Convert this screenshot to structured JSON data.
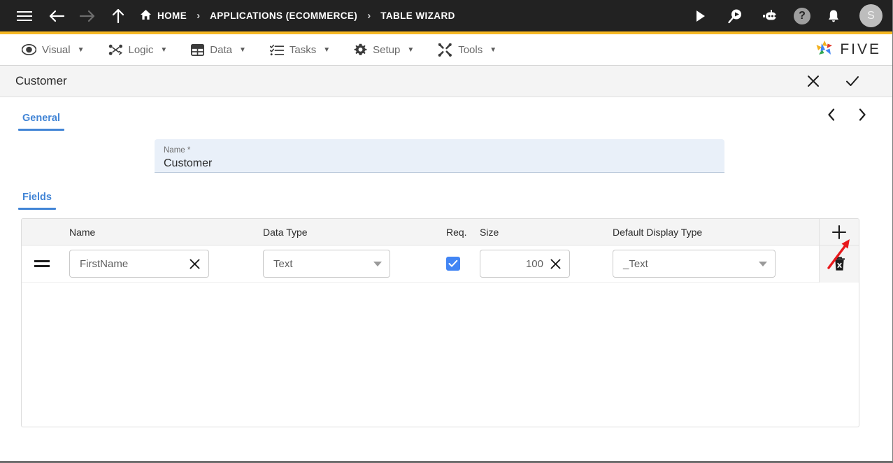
{
  "topbar": {
    "menu_icon": "hamburger-icon",
    "back_icon": "arrow-left-icon",
    "forward_icon": "arrow-right-icon",
    "up_icon": "arrow-up-icon",
    "breadcrumbs": [
      {
        "label": "HOME",
        "icon": "home-icon"
      },
      {
        "label": "APPLICATIONS (ECOMMERCE)",
        "icon": ""
      },
      {
        "label": "TABLE WIZARD",
        "icon": ""
      }
    ],
    "separator": "›",
    "actions": [
      {
        "name": "run-icon",
        "glyph": "▶"
      },
      {
        "name": "search-chat-icon",
        "glyph": ""
      },
      {
        "name": "chatbot-icon",
        "glyph": ""
      },
      {
        "name": "help-icon",
        "glyph": "?"
      },
      {
        "name": "notifications-bell-icon",
        "glyph": ""
      }
    ],
    "avatar_initial": "S",
    "accent_color": "#f6b823",
    "bg_color": "#222222"
  },
  "menubar": {
    "items": [
      {
        "label": "Visual",
        "icon": "eye-icon",
        "caret": "▼"
      },
      {
        "label": "Logic",
        "icon": "logic-nodes-icon",
        "caret": "▼"
      },
      {
        "label": "Data",
        "icon": "table-grid-icon",
        "caret": "▼"
      },
      {
        "label": "Tasks",
        "icon": "checklist-icon",
        "caret": "▼"
      },
      {
        "label": "Setup",
        "icon": "gear-icon",
        "caret": "▼"
      },
      {
        "label": "Tools",
        "icon": "tools-crossed-icon",
        "caret": "▼"
      }
    ],
    "brand": {
      "text": "FIVE",
      "logo": "five-star-logo"
    }
  },
  "record_header": {
    "title": "Customer",
    "cancel_icon": "close-icon",
    "confirm_icon": "check-icon"
  },
  "tabs": {
    "general": {
      "label": "General",
      "active": true
    },
    "fields": {
      "label": "Fields",
      "active": true
    },
    "prev_icon": "chevron-left-icon",
    "next_icon": "chevron-right-icon"
  },
  "name_field": {
    "label": "Name *",
    "value": "Customer",
    "placeholder": "Name"
  },
  "grid": {
    "columns": [
      "Name",
      "Data Type",
      "Req.",
      "Size",
      "Default Display Type"
    ],
    "add_icon": "plus-icon",
    "delete_icon": "trash-icon",
    "rows": [
      {
        "handle": "drag-handle-icon",
        "name": "FirstName",
        "name_clear": "clear-icon",
        "data_type": "Text",
        "required": true,
        "size": "100",
        "size_clear": "clear-icon",
        "default_display_type": "_Text"
      }
    ]
  },
  "annotation": {
    "arrow": "red-arrow-pointing-to-add-button",
    "color": "#e8191c"
  },
  "colors": {
    "accent_blue": "#4285d6",
    "checkbox_blue": "#4285f4",
    "field_bg": "#e9f0f9",
    "header_bg": "#222222",
    "accent_yellow": "#f6b823"
  }
}
